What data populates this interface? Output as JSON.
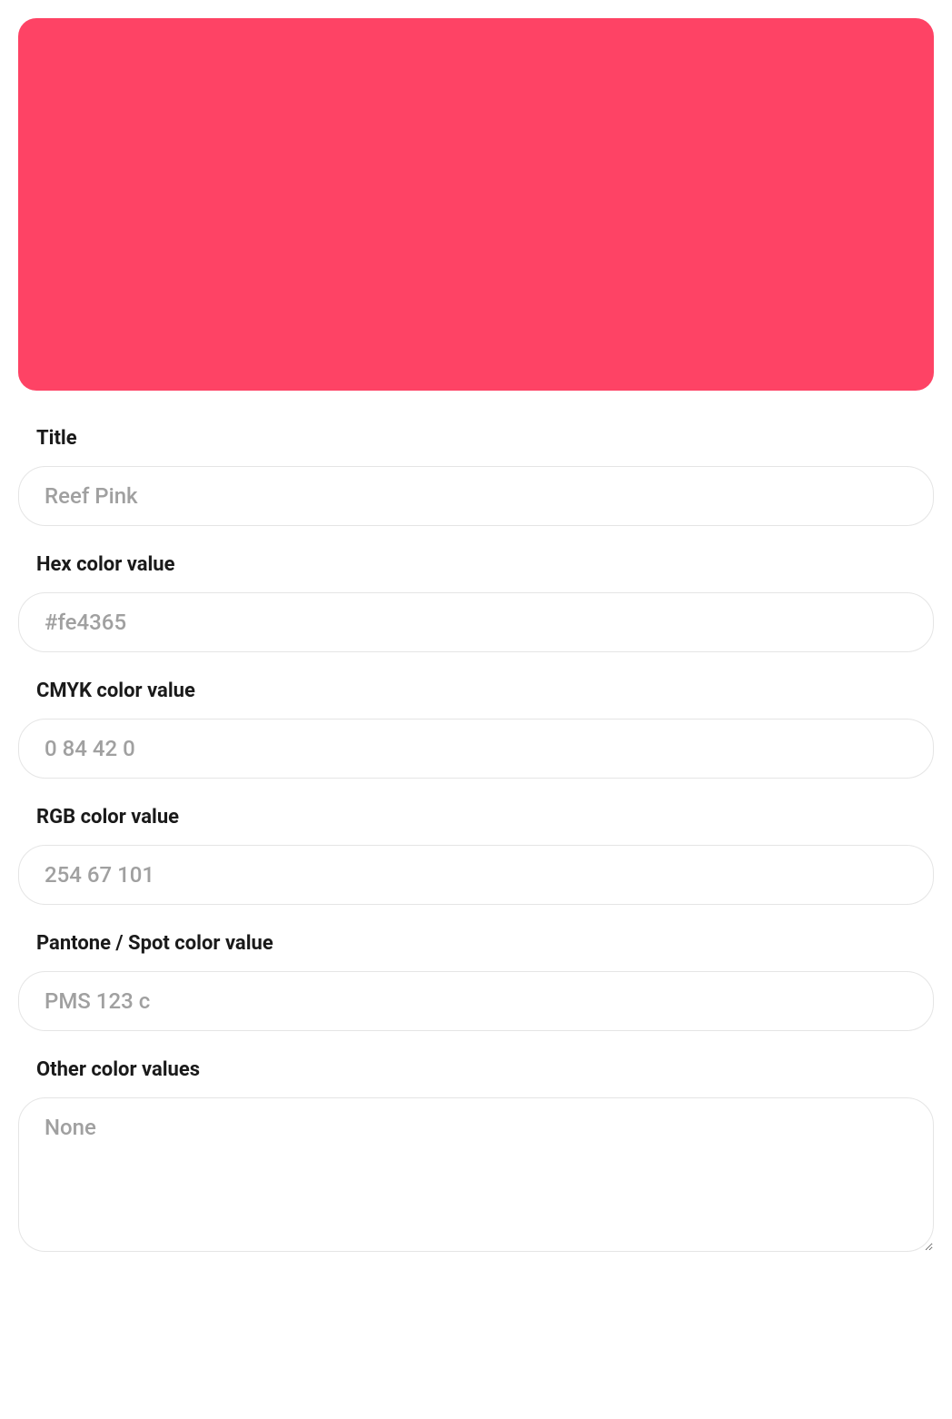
{
  "color_swatch": {
    "hex": "#fe4365"
  },
  "fields": {
    "title": {
      "label": "Title",
      "placeholder": "Reef Pink",
      "value": ""
    },
    "hex": {
      "label": "Hex color value",
      "placeholder": "#fe4365",
      "value": ""
    },
    "cmyk": {
      "label": "CMYK color value",
      "placeholder": "0 84 42 0",
      "value": ""
    },
    "rgb": {
      "label": "RGB color value",
      "placeholder": "254 67 101",
      "value": ""
    },
    "pantone": {
      "label": "Pantone / Spot color value",
      "placeholder": "PMS 123 c",
      "value": ""
    },
    "other": {
      "label": "Other color values",
      "placeholder": "None",
      "value": ""
    }
  }
}
